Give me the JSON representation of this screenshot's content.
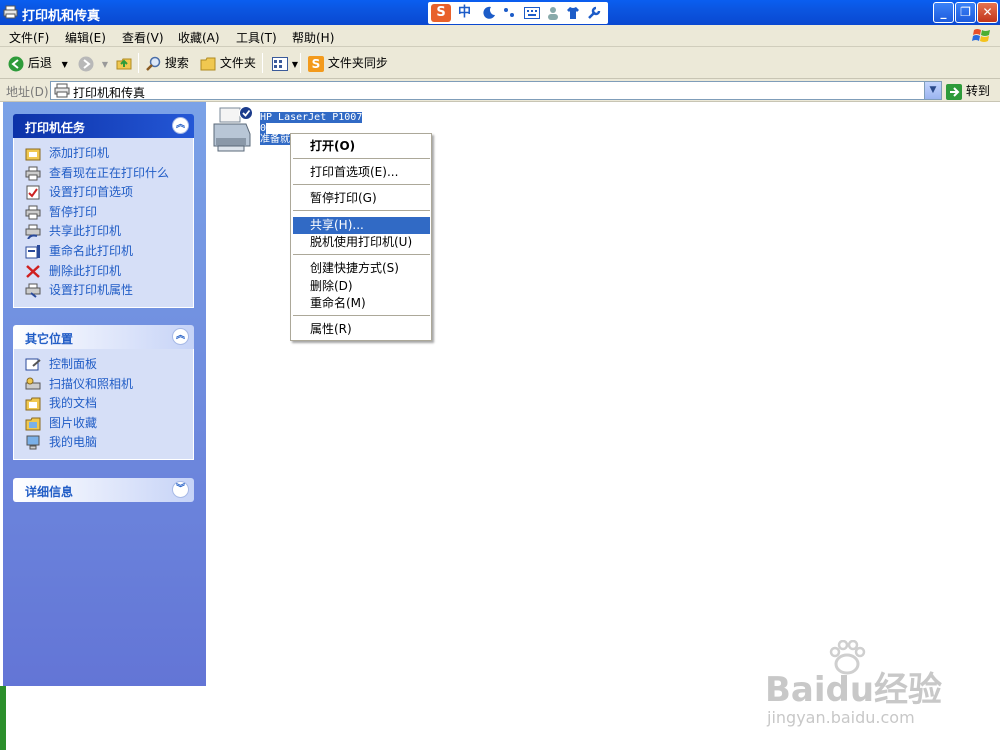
{
  "window": {
    "title": "打印机和传真"
  },
  "ime": {
    "logo": "S",
    "mode": "中",
    "icons": [
      "moon-icon",
      "punctuation-icon",
      "keyboard-icon",
      "user-icon",
      "shirt-icon",
      "wrench-icon"
    ]
  },
  "menubar": {
    "items": [
      {
        "label": "文件(F)"
      },
      {
        "label": "编辑(E)"
      },
      {
        "label": "查看(V)"
      },
      {
        "label": "收藏(A)"
      },
      {
        "label": "工具(T)"
      },
      {
        "label": "帮助(H)"
      }
    ]
  },
  "toolbar": {
    "back_label": "后退",
    "search_label": "搜索",
    "folders_label": "文件夹",
    "sync_label": "文件夹同步"
  },
  "addressbar": {
    "label": "地址(D)",
    "value": "打印机和传真",
    "go_label": "转到"
  },
  "taskpane": {
    "printer_tasks": {
      "title": "打印机任务",
      "items": [
        {
          "label": "添加打印机",
          "icon": "add-printer-icon"
        },
        {
          "label": "查看现在正在打印什么",
          "icon": "print-queue-icon"
        },
        {
          "label": "设置打印首选项",
          "icon": "preferences-icon"
        },
        {
          "label": "暂停打印",
          "icon": "pause-printer-icon"
        },
        {
          "label": "共享此打印机",
          "icon": "share-printer-icon"
        },
        {
          "label": "重命名此打印机",
          "icon": "rename-icon"
        },
        {
          "label": "删除此打印机",
          "icon": "delete-icon"
        },
        {
          "label": "设置打印机属性",
          "icon": "printer-properties-icon"
        }
      ]
    },
    "other_places": {
      "title": "其它位置",
      "items": [
        {
          "label": "控制面板",
          "icon": "control-panel-icon"
        },
        {
          "label": "扫描仪和照相机",
          "icon": "scanner-icon"
        },
        {
          "label": "我的文档",
          "icon": "my-documents-icon"
        },
        {
          "label": "图片收藏",
          "icon": "my-pictures-icon"
        },
        {
          "label": "我的电脑",
          "icon": "my-computer-icon"
        }
      ]
    },
    "details": {
      "title": "详细信息"
    }
  },
  "printer": {
    "name": "HP LaserJet P1007",
    "docs": "0",
    "status": "准备就绪"
  },
  "context_menu": {
    "items": [
      {
        "label": "打开(O)",
        "bold": true
      },
      {
        "label": "打印首选项(E)..."
      },
      {
        "label": "暂停打印(G)"
      },
      {
        "label": "共享(H)...",
        "highlighted": true
      },
      {
        "label": "脱机使用打印机(U)"
      },
      {
        "label": "创建快捷方式(S)"
      },
      {
        "label": "删除(D)"
      },
      {
        "label": "重命名(M)"
      },
      {
        "label": "属性(R)"
      }
    ]
  },
  "watermark": {
    "brand": "Baidu经验",
    "url": "jingyan.baidu.com"
  },
  "colors": {
    "titlebar": "#0a5ef0",
    "taskpane": "#7ba2e7",
    "selection": "#316ac5",
    "link": "#215dc6"
  }
}
